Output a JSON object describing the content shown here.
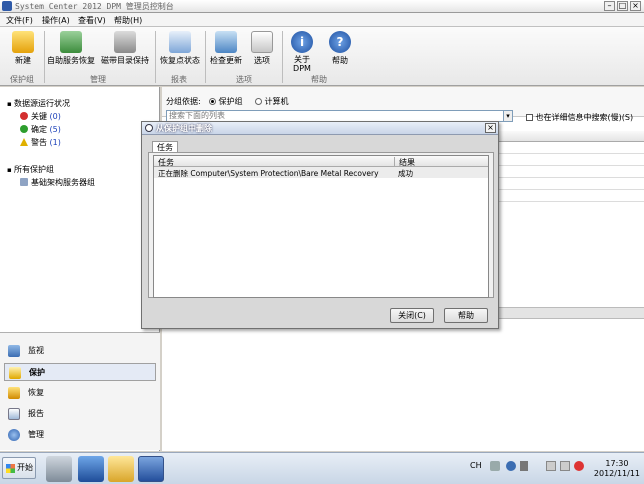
{
  "window": {
    "title": "System Center 2012 DPM 管理员控制台",
    "btn_min": "–",
    "btn_max": "□",
    "btn_close": "×"
  },
  "menu": [
    "文件(F)",
    "操作(A)",
    "查看(V)",
    "帮助(H)"
  ],
  "toolbar": {
    "buttons": [
      {
        "label": "新建",
        "icon": "new-icon"
      },
      {
        "label": "自助服务恢复",
        "icon": "self-service-icon"
      },
      {
        "label": "磁带目录保持",
        "icon": "tape-icon"
      },
      {
        "label": "恢复点状态",
        "icon": "recovery-point-icon"
      },
      {
        "label": "检查更新",
        "icon": "update-icon"
      },
      {
        "label": "选项",
        "icon": "options-icon"
      },
      {
        "label": "关于\nDPM",
        "icon": "info-icon"
      },
      {
        "label": "帮助",
        "icon": "help-icon"
      }
    ],
    "groups": [
      "保护组",
      "管理",
      "报表",
      "选项",
      "帮助"
    ]
  },
  "sidebar": {
    "status_header": "数据源运行状况",
    "status": [
      {
        "label": "关键",
        "count": "(0)",
        "color": "#d32f2f"
      },
      {
        "label": "确定",
        "count": "(5)",
        "color": "#2e9e2e"
      },
      {
        "label": "警告",
        "count": "(1)",
        "color": "#e0b000"
      }
    ],
    "groups_header": "所有保护组",
    "groups": [
      "基础架构服务器组"
    ],
    "nav": [
      {
        "label": "监视",
        "icon": "monitor-icon"
      },
      {
        "label": "保护",
        "icon": "protect-icon",
        "selected": true
      },
      {
        "label": "恢复",
        "icon": "recover-icon"
      },
      {
        "label": "报告",
        "icon": "report-icon"
      },
      {
        "label": "管理",
        "icon": "manage-icon"
      }
    ]
  },
  "main": {
    "group_by_label": "分组依据:",
    "radio_protection_group": "保护组",
    "radio_computer": "计算机",
    "search_placeholder": "搜索下面的列表",
    "detail_search_label": "也在详细信息中搜索(慢)(S)"
  },
  "dialog": {
    "title": "从保护组中删除",
    "tab": "任务",
    "columns": [
      "任务",
      "结果"
    ],
    "rows": [
      {
        "task": "正在删除 Computer\\System Protection\\Bare Metal Recovery",
        "result": "成功"
      }
    ],
    "close_button": "关闭(C)",
    "help_button": "帮助"
  },
  "taskbar": {
    "start_label": "开始",
    "tray_lang": "CH",
    "clock_time": "17:30",
    "clock_date": "2012/11/11"
  }
}
